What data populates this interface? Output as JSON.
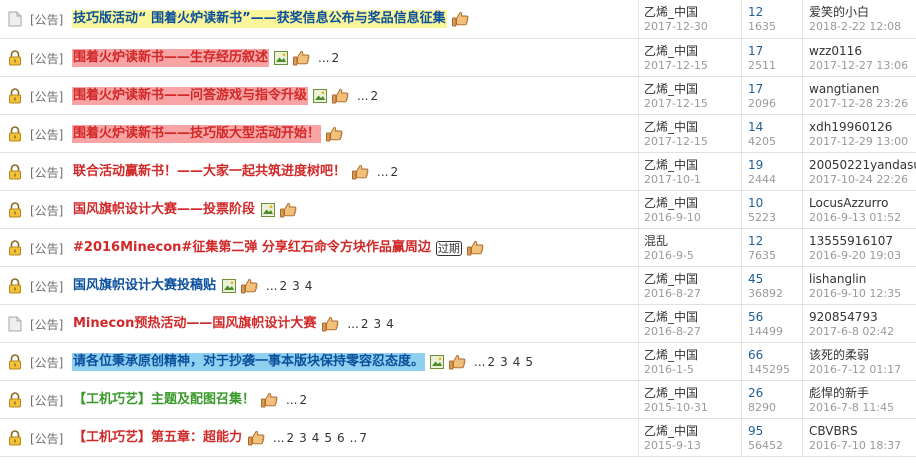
{
  "threads": [
    {
      "prefix": "[公告]",
      "icon": "page-icon",
      "title": "技巧版活动“ 围着火炉读新书”——获奖信息公布与奖品信息征集",
      "color": "blue",
      "highlight": "yellow",
      "image": false,
      "tag": "",
      "pages": [],
      "author": "乙烯_中国",
      "date": "2017-12-30",
      "replies": "12",
      "views": "1635",
      "last_user": "爱笑的小白",
      "last_time": "2018-2-22 12:08"
    },
    {
      "prefix": "[公告]",
      "icon": "lock-icon",
      "title": "围着火炉读新书——生存经历叙述",
      "color": "red",
      "highlight": "pink",
      "image": true,
      "tag": "",
      "pages": [
        "...",
        "2"
      ],
      "author": "乙烯_中国",
      "date": "2017-12-15",
      "replies": "17",
      "views": "2511",
      "last_user": "wzz0116",
      "last_time": "2017-12-27 13:06"
    },
    {
      "prefix": "[公告]",
      "icon": "lock-icon",
      "title": "围着火炉读新书——问答游戏与指令升级",
      "color": "red",
      "highlight": "pink",
      "image": true,
      "tag": "",
      "pages": [
        "...",
        "2"
      ],
      "author": "乙烯_中国",
      "date": "2017-12-15",
      "replies": "17",
      "views": "2096",
      "last_user": "wangtianen",
      "last_time": "2017-12-28 23:26"
    },
    {
      "prefix": "[公告]",
      "icon": "lock-icon",
      "title": "围着火炉读新书——技巧版大型活动开始！",
      "color": "red",
      "highlight": "pink",
      "image": false,
      "tag": "",
      "pages": [],
      "author": "乙烯_中国",
      "date": "2017-12-15",
      "replies": "14",
      "views": "4205",
      "last_user": "xdh19960126",
      "last_time": "2017-12-29 13:00"
    },
    {
      "prefix": "[公告]",
      "icon": "lock-icon",
      "title": "联合活动赢新书！——大家一起共筑进度树吧！",
      "color": "red",
      "highlight": "",
      "image": false,
      "tag": "",
      "pages": [
        "...",
        "2"
      ],
      "author": "乙烯_中国",
      "date": "2017-10-1",
      "replies": "19",
      "views": "2444",
      "last_user": "20050221yandasu",
      "last_time": "2017-10-24 22:26"
    },
    {
      "prefix": "[公告]",
      "icon": "lock-icon",
      "title": "国风旗帜设计大赛——投票阶段",
      "color": "red",
      "highlight": "",
      "image": true,
      "tag": "",
      "pages": [],
      "author": "乙烯_中国",
      "date": "2016-9-10",
      "replies": "10",
      "views": "5223",
      "last_user": "LocusAzzurro",
      "last_time": "2016-9-13 01:52"
    },
    {
      "prefix": "[公告]",
      "icon": "lock-icon",
      "title": "#2016Minecon#征集第二弹 分享红石命令方块作品赢周边",
      "color": "red",
      "highlight": "",
      "image": false,
      "tag": "过期",
      "pages": [],
      "author": "混乱",
      "date": "2016-9-5",
      "replies": "12",
      "views": "7635",
      "last_user": "13555916107",
      "last_time": "2016-9-20 19:03"
    },
    {
      "prefix": "[公告]",
      "icon": "lock-icon",
      "title": "国风旗帜设计大赛投稿贴",
      "color": "blue",
      "highlight": "",
      "image": true,
      "tag": "",
      "pages": [
        "...",
        "2",
        "3",
        "4"
      ],
      "author": "乙烯_中国",
      "date": "2016-8-27",
      "replies": "45",
      "views": "36892",
      "last_user": "lishanglin",
      "last_time": "2016-9-10 12:35"
    },
    {
      "prefix": "[公告]",
      "icon": "page-icon",
      "title": "Minecon预热活动——国风旗帜设计大赛",
      "color": "red",
      "highlight": "",
      "image": false,
      "tag": "",
      "pages": [
        "...",
        "2",
        "3",
        "4"
      ],
      "author": "乙烯_中国",
      "date": "2016-8-27",
      "replies": "56",
      "views": "14499",
      "last_user": "920854793",
      "last_time": "2017-6-8 02:42"
    },
    {
      "prefix": "[公告]",
      "icon": "lock-icon",
      "title": "请各位秉承原创精神，对于抄袭一事本版块保持零容忍态度。",
      "color": "blue",
      "highlight": "cyan",
      "image": true,
      "tag": "",
      "pages": [
        "...",
        "2",
        "3",
        "4",
        "5"
      ],
      "author": "乙烯_中国",
      "date": "2016-1-5",
      "replies": "66",
      "views": "145295",
      "last_user": "该死的柔弱",
      "last_time": "2016-7-12 01:17"
    },
    {
      "prefix": "[公告]",
      "icon": "lock-icon",
      "title": "【工机巧艺】主题及配图召集！",
      "color": "green",
      "highlight": "",
      "image": false,
      "tag": "",
      "pages": [
        "...",
        "2"
      ],
      "author": "乙烯_中国",
      "date": "2015-10-31",
      "replies": "26",
      "views": "8290",
      "last_user": "彪悍的新手",
      "last_time": "2016-7-8 11:45"
    },
    {
      "prefix": "[公告]",
      "icon": "lock-icon",
      "title": "【工机巧艺】第五章：超能力",
      "color": "red",
      "highlight": "",
      "image": false,
      "tag": "",
      "pages": [
        "...",
        "2",
        "3",
        "4",
        "5",
        "6",
        "..",
        "7"
      ],
      "author": "乙烯_中国",
      "date": "2015-9-13",
      "replies": "95",
      "views": "56452",
      "last_user": "CBVBRS",
      "last_time": "2016-7-10 18:37"
    }
  ]
}
